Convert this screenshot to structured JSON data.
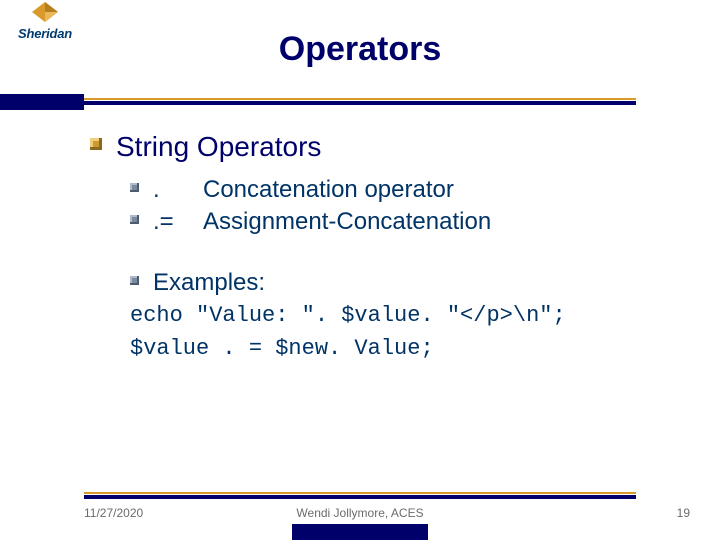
{
  "logo_text": "Sheridan",
  "title": "Operators",
  "section_heading": "String Operators",
  "operators": [
    {
      "symbol": ".",
      "desc": "Concatenation operator"
    },
    {
      "symbol": ".=",
      "desc": "Assignment-Concatenation"
    }
  ],
  "examples_label": "Examples:",
  "code_lines": [
    "echo \"Value: \". $value. \"</p>\\n\";",
    "$value . = $new. Value;"
  ],
  "footer": {
    "date": "11/27/2020",
    "author": "Wendi Jollymore, ACES",
    "page": "19"
  }
}
